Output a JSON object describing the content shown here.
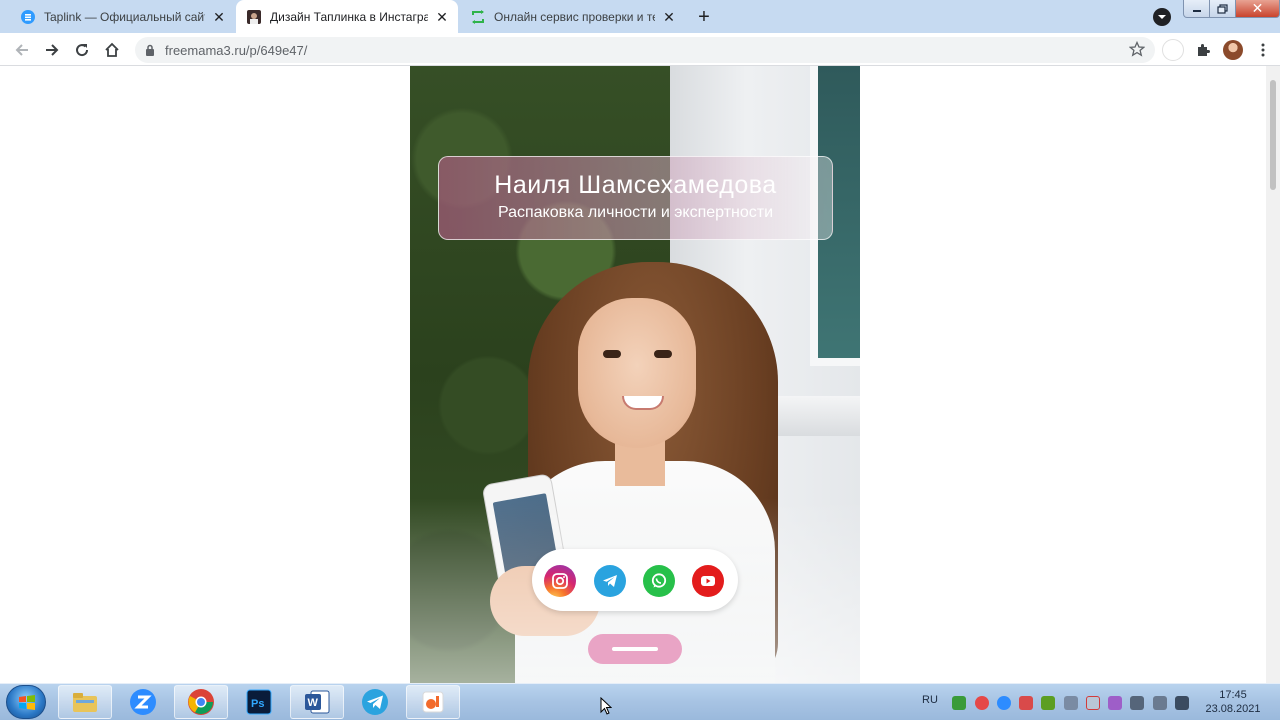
{
  "browser": {
    "tabs": [
      {
        "title": "Taplink — Официальный сайт: М",
        "active": false,
        "icon": "taplink-favicon"
      },
      {
        "title": "Дизайн Таплинка в Инстаграм.",
        "active": true,
        "icon": "instagram-favicon"
      },
      {
        "title": "Онлайн сервис проверки и тест",
        "active": false,
        "icon": "service-favicon"
      }
    ],
    "newtab_symbol": "+",
    "window_controls": {
      "minimize": "—",
      "maximize": "❐",
      "close": "✕"
    },
    "url": "freemama3.ru/p/649e47/"
  },
  "page": {
    "profile_name": "Наиля Шамсехамедова",
    "profile_subtitle": "Распаковка личности и экспертности",
    "social_links": [
      {
        "name": "instagram",
        "icon": "instagram-icon",
        "color": "#d6266f"
      },
      {
        "name": "telegram",
        "icon": "telegram-icon",
        "color": "#2aa3df"
      },
      {
        "name": "whatsapp",
        "icon": "whatsapp-icon",
        "color": "#27c04a"
      },
      {
        "name": "youtube",
        "icon": "youtube-icon",
        "color": "#e31c1c"
      }
    ],
    "accent_color": "#e9a4c5"
  },
  "taskbar": {
    "apps": [
      "file-explorer",
      "zoom",
      "chrome",
      "photoshop",
      "word",
      "telegram",
      "paint-app"
    ],
    "language": "RU",
    "time": "17:45",
    "date": "23.08.2021"
  }
}
